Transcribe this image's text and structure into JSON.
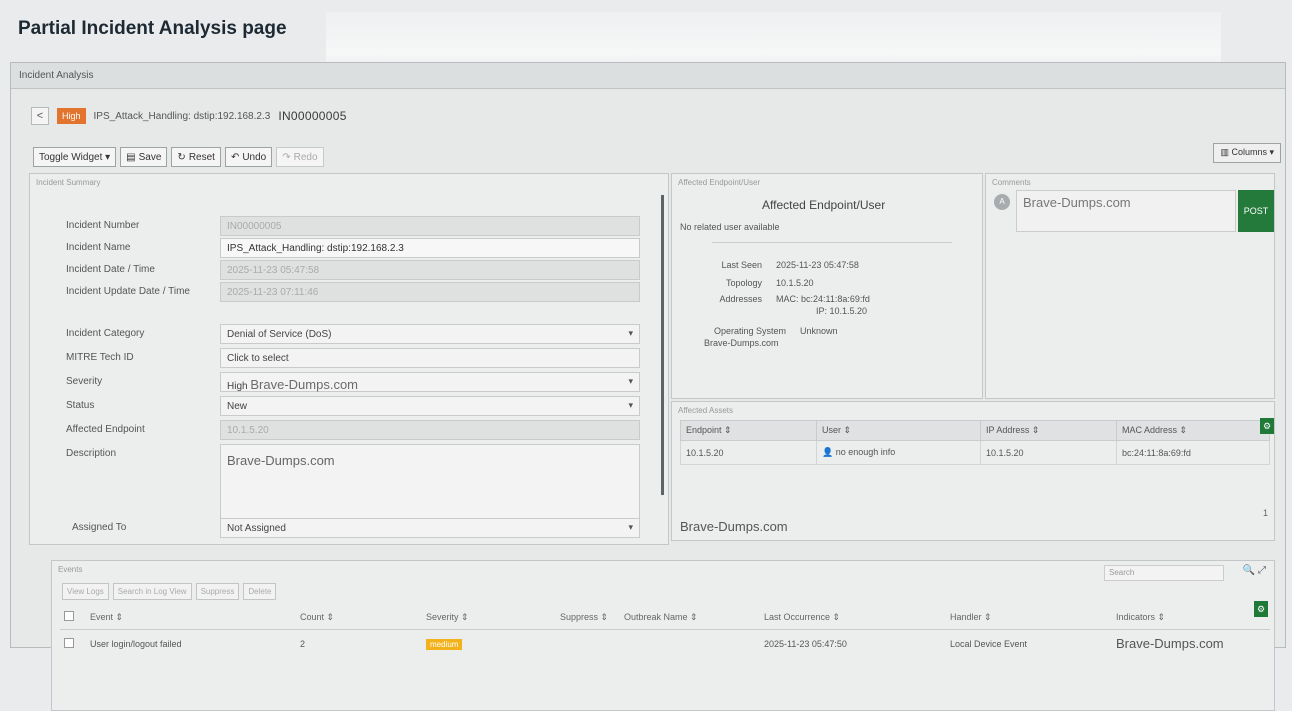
{
  "page_heading": "Partial Incident Analysis page",
  "window_title": "Incident Analysis",
  "header": {
    "back_glyph": "<",
    "severity_badge": "High",
    "incident_title": "IPS_Attack_Handling: dstip:192.168.2.3",
    "incident_id": "IN00000005"
  },
  "toolbar": {
    "toggle_widget": "Toggle Widget ▾",
    "save": "Save",
    "reset": "Reset",
    "undo": "Undo",
    "redo": "Redo",
    "columns": "Columns ▾"
  },
  "summary": {
    "caption": "Incident Summary",
    "fields": [
      {
        "label": "Incident Number",
        "value": "IN00000005",
        "kind": "ro"
      },
      {
        "label": "Incident Name",
        "value": "IPS_Attack_Handling: dstip:192.168.2.3",
        "kind": "text"
      },
      {
        "label": "Incident Date / Time",
        "value": "2025-11-23 05:47:58",
        "kind": "ro"
      },
      {
        "label": "Incident Update Date / Time",
        "value": "2025-11-23 07:11:46",
        "kind": "ro"
      },
      {
        "label": "Incident Category",
        "value": "Denial of Service (DoS)",
        "kind": "select"
      },
      {
        "label": "MITRE Tech ID",
        "value": "Click to select",
        "kind": "text"
      },
      {
        "label": "Severity",
        "value": "High",
        "kind": "select"
      },
      {
        "label": "Status",
        "value": "New",
        "kind": "select"
      },
      {
        "label": "Affected Endpoint",
        "value": "10.1.5.20",
        "kind": "ro"
      },
      {
        "label": "Description",
        "value": "Brave-Dumps.com",
        "kind": "textarea"
      },
      {
        "label": "Assigned To",
        "value": "Not Assigned",
        "kind": "select"
      }
    ],
    "severity_watermark": "Brave-Dumps.com"
  },
  "endpoint": {
    "caption": "Affected Endpoint/User",
    "title": "Affected Endpoint/User",
    "no_user": "No related user available",
    "last_seen_label": "Last Seen",
    "last_seen": "2025-11-23 05:47:58",
    "topology_label": "Topology",
    "topology": "10.1.5.20",
    "addresses_label": "Addresses",
    "mac": "MAC: bc:24:11:8a:69:fd",
    "ip": "IP: 10.1.5.20",
    "os_label": "Operating System",
    "os": "Unknown",
    "watermark": "Brave-Dumps.com"
  },
  "comments": {
    "caption": "Comments",
    "avatar_letter": "A",
    "input_value": "Brave-Dumps.com",
    "post": "POST"
  },
  "assets": {
    "caption": "Affected Assets",
    "columns": [
      "Endpoint ⇕",
      "User ⇕",
      "IP Address ⇕",
      "MAC Address ⇕"
    ],
    "rows": [
      {
        "endpoint": "10.1.5.20",
        "user": "no enough info",
        "ip": "10.1.5.20",
        "mac": "bc:24:11:8a:69:fd"
      }
    ],
    "footer_watermark": "Brave-Dumps.com",
    "page": "1"
  },
  "events": {
    "caption": "Events",
    "search_placeholder": "Search",
    "buttons": [
      "View Logs",
      "Search in Log View",
      "Suppress",
      "Delete"
    ],
    "columns": [
      "Event ⇕",
      "Count ⇕",
      "Severity ⇕",
      "Suppress ⇕",
      "Outbreak Name ⇕",
      "Last Occurrence ⇕",
      "Handler ⇕",
      "Indicators ⇕"
    ],
    "rows": [
      {
        "event": "User login/logout failed",
        "count": "2",
        "severity": "medium",
        "suppress": "",
        "outbreak": "",
        "last": "2025-11-23 05:47:50",
        "handler": "Local Device Event",
        "indicators": "Brave-Dumps.com"
      }
    ]
  },
  "colors": {
    "accent_green": "#247a3b",
    "high": "#e2742e",
    "medium": "#f3b21c"
  }
}
